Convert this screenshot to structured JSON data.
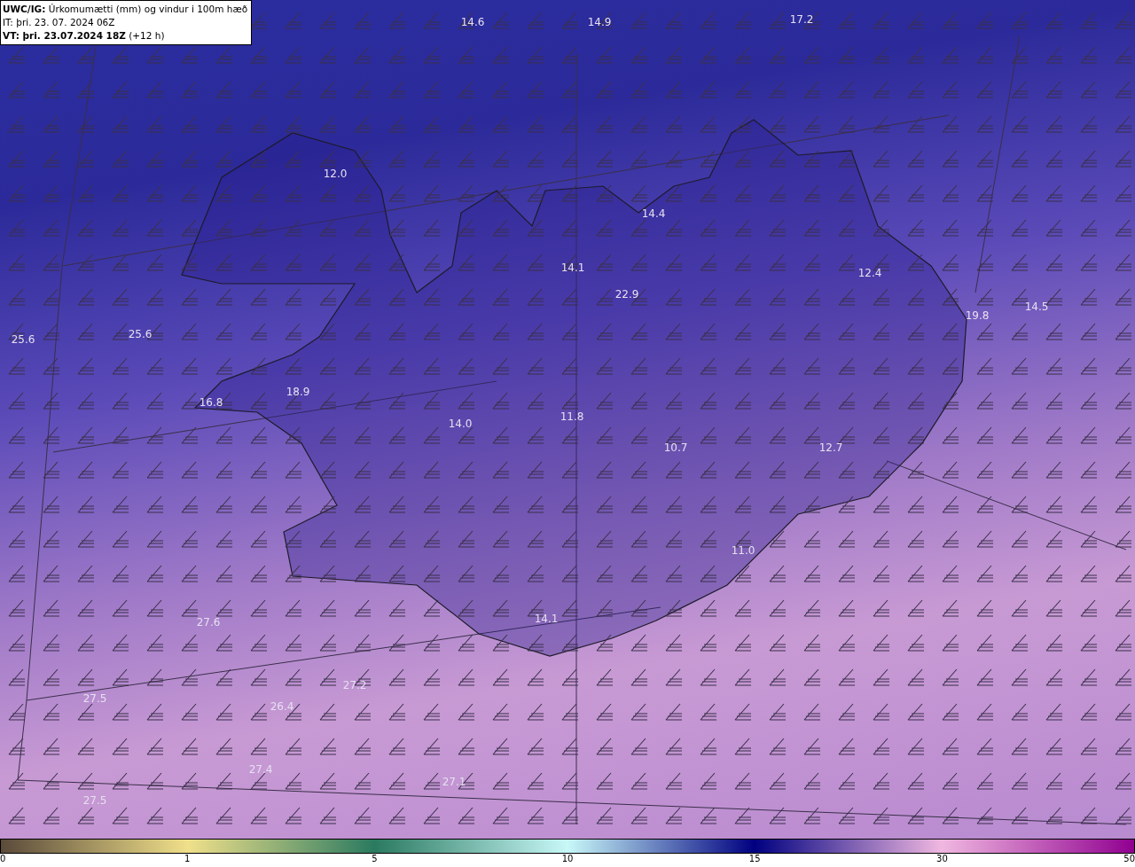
{
  "header": {
    "title": "**UWC/IG:** Úrkomumætti (mm) og vindur i 100m hæð",
    "initial_time": "IT: þri. 23. 07. 2024 06Z",
    "valid_time": "**VT: þri. 23.07.2024 18Z** (+12 h)"
  },
  "map_labels": [
    "14.6",
    "14.9",
    "17.2",
    "12.0",
    "14.4",
    "14.1",
    "22.9",
    "12.4",
    "19.8",
    "14.5",
    "25.6",
    "25.6",
    "18.9",
    "16.8",
    "14.0",
    "11.8",
    "10.7",
    "12.7",
    "11.0",
    "14.1",
    "27.6",
    "27.2",
    "27.5",
    "26.4",
    "27.4",
    "27.1",
    "27.5"
  ],
  "legend": {
    "ticks": [
      "0",
      "1",
      "5",
      "10",
      "15",
      "30",
      "50"
    ]
  }
}
